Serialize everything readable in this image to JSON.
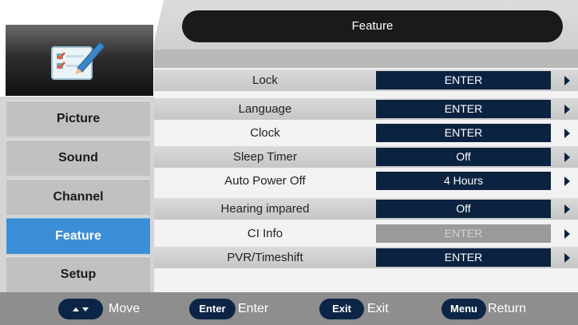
{
  "header": {
    "title": "Feature"
  },
  "sidebar": {
    "items": [
      {
        "label": "Picture",
        "active": false
      },
      {
        "label": "Sound",
        "active": false
      },
      {
        "label": "Channel",
        "active": false
      },
      {
        "label": "Feature",
        "active": true
      },
      {
        "label": "Setup",
        "active": false
      }
    ]
  },
  "menu": {
    "rows": [
      {
        "label": "Lock",
        "value": "ENTER",
        "enabled": true
      },
      {
        "label": "Language",
        "value": "ENTER",
        "enabled": true
      },
      {
        "label": "Clock",
        "value": "ENTER",
        "enabled": true
      },
      {
        "label": "Sleep Timer",
        "value": "Off",
        "enabled": true
      },
      {
        "label": "Auto Power Off",
        "value": "4 Hours",
        "enabled": true
      },
      {
        "label": "Hearing impared",
        "value": "Off",
        "enabled": true
      },
      {
        "label": "CI Info",
        "value": "ENTER",
        "enabled": false
      },
      {
        "label": "PVR/Timeshift",
        "value": "ENTER",
        "enabled": true
      }
    ]
  },
  "footer": {
    "move": {
      "key_icon": "up-down-arrows-icon",
      "label": "Move"
    },
    "enter": {
      "key": "Enter",
      "label": "Enter"
    },
    "exit": {
      "key": "Exit",
      "label": "Exit"
    },
    "menu": {
      "key": "Menu",
      "label": "Return"
    }
  },
  "colors": {
    "accent": "#3b8ed6",
    "value_bg": "#0b2341",
    "disabled_bg": "#9a9a9a",
    "footer_bg": "#8e8e8e",
    "title_bg": "#1a1a1a"
  }
}
